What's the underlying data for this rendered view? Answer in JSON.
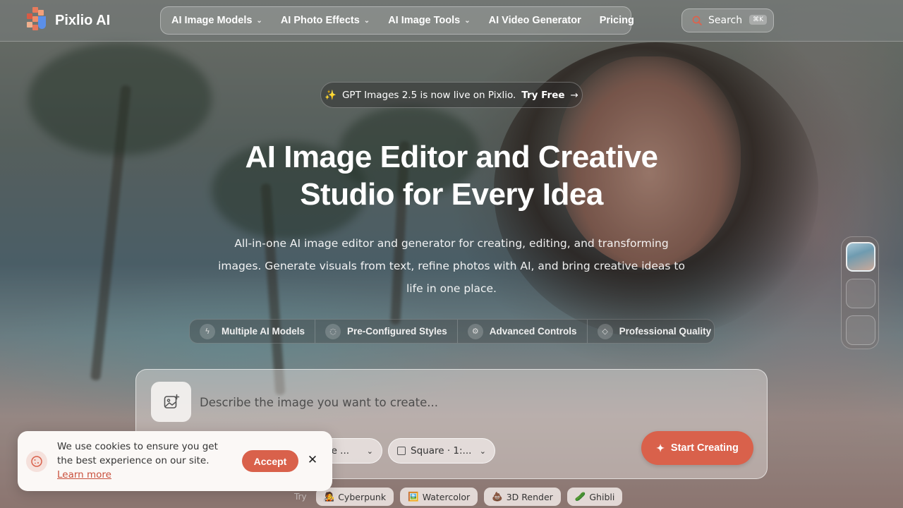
{
  "brand": {
    "name": "Pixlio AI"
  },
  "nav": {
    "items": [
      {
        "label": "AI Image Models",
        "has_dropdown": true
      },
      {
        "label": "AI Photo Effects",
        "has_dropdown": true
      },
      {
        "label": "AI Image Tools",
        "has_dropdown": true
      },
      {
        "label": "AI Video Generator",
        "has_dropdown": false
      },
      {
        "label": "Pricing",
        "has_dropdown": false
      }
    ],
    "search": {
      "label": "Search",
      "shortcut": "⌘K"
    }
  },
  "announcement": {
    "emoji": "✨",
    "text": "GPT Images 2.5 is now live on Pixlio.",
    "cta": "Try Free",
    "cta_arrow": "→"
  },
  "hero": {
    "title_line1": "AI Image Editor and Creative",
    "title_line2": "Studio for Every Idea",
    "subtitle": "All-in-one AI image editor and generator for creating, editing, and transforming images. Generate visuals from text, refine photos with AI, and bring creative ideas to life in one place."
  },
  "features": [
    {
      "label": "Multiple AI Models",
      "icon": "bolt-icon"
    },
    {
      "label": "Pre-Configured Styles",
      "icon": "palette-icon"
    },
    {
      "label": "Advanced Controls",
      "icon": "settings-icon"
    },
    {
      "label": "Professional Quality",
      "icon": "diamond-icon"
    }
  ],
  "prompt": {
    "placeholder": "Describe the image you want to create...",
    "model_select": "ge ...",
    "ratio_select": "Square · 1:...",
    "start_button": "Start Creating"
  },
  "try": {
    "label": "Try",
    "chips": [
      {
        "emoji": "🧑‍🎤",
        "label": "Cyberpunk"
      },
      {
        "emoji": "🖼️",
        "label": "Watercolor"
      },
      {
        "emoji": "💩",
        "label": "3D Render"
      },
      {
        "emoji": "🥒",
        "label": "Ghibli"
      }
    ]
  },
  "cookie": {
    "text": "We use cookies to ensure you get the best experience on our site.",
    "link": "Learn more",
    "accept": "Accept",
    "close": "✕"
  },
  "colors": {
    "accent": "#d9614b",
    "cookie_bg": "#fbf8f6"
  }
}
